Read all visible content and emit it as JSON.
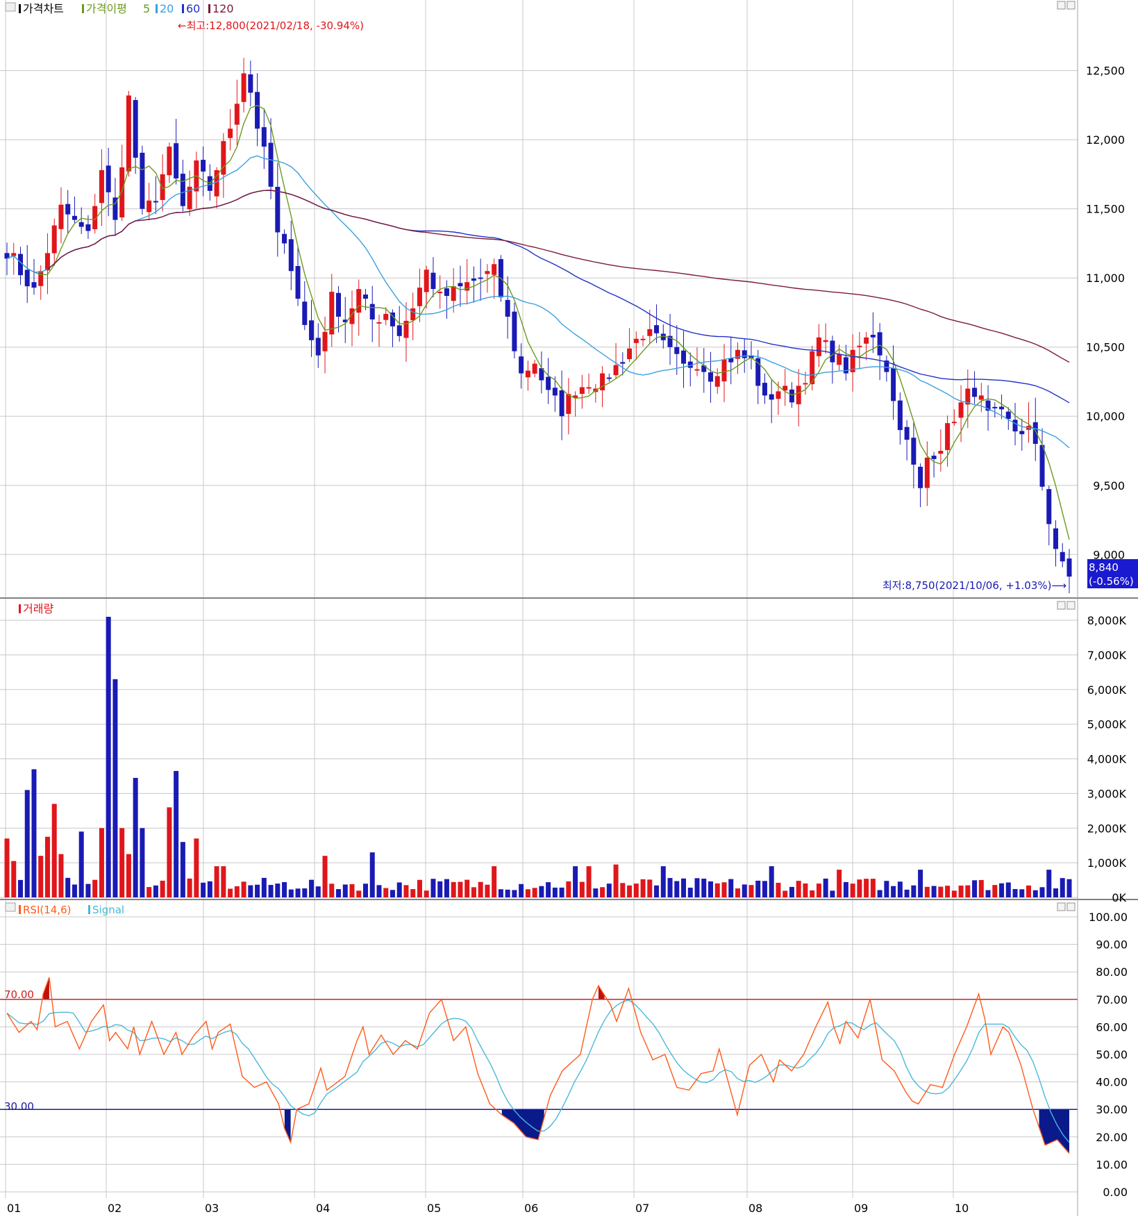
{
  "colors": {
    "up": "#e0161b",
    "down": "#1a1ab4",
    "ma5": "#6a9a1c",
    "ma20": "#3aa0e0",
    "ma60": "#2030c8",
    "ma120": "#7a1a3a",
    "rsi": "#ff5a1a",
    "signal": "#4ab8d8",
    "grid": "#c8c8c8",
    "line70": "#d02020",
    "line30": "#1a1aa0"
  },
  "price_panel": {
    "legend": {
      "title": "가격차트",
      "ma_label": "가격이평",
      "ma5": "5",
      "ma20": "20",
      "ma60": "60",
      "ma120": "120"
    },
    "high_note": "←최고:12,800(2021/02/18, -30.94%)",
    "low_note": "최저:8,750(2021/10/06, +1.03%)⟶",
    "last_price": "8,840",
    "last_change": "(-0.56%)",
    "y_ticks": [
      "12,500",
      "12,000",
      "11,500",
      "11,000",
      "10,500",
      "10,000",
      "9,500",
      "9,000"
    ]
  },
  "volume_panel": {
    "legend": "거래량",
    "y_ticks": [
      "8,000K",
      "7,000K",
      "6,000K",
      "5,000K",
      "4,000K",
      "3,000K",
      "2,000K",
      "1,000K",
      "0K"
    ]
  },
  "rsi_panel": {
    "legend_rsi": "RSI(14,6)",
    "legend_signal": "Signal",
    "level_high": "70.00",
    "level_low": "30.00",
    "y_ticks": [
      "100.00",
      "90.00",
      "80.00",
      "70.00",
      "60.00",
      "50.00",
      "40.00",
      "30.00",
      "20.00",
      "10.00",
      "0.00"
    ]
  },
  "x_ticks": [
    "01",
    "02",
    "03",
    "04",
    "05",
    "06",
    "07",
    "08",
    "09",
    "10"
  ],
  "chart_data": [
    {
      "type": "candlestick",
      "title": "가격차트",
      "period": "2021/01 - 2021/10",
      "ylim": [
        8700,
        12900
      ],
      "anchors": [
        [
          0,
          11200
        ],
        [
          4,
          10900
        ],
        [
          8,
          11500
        ],
        [
          12,
          11300
        ],
        [
          14,
          11800
        ],
        [
          16,
          11400
        ],
        [
          18,
          12300
        ],
        [
          20,
          11450
        ],
        [
          22,
          11600
        ],
        [
          24,
          11900
        ],
        [
          26,
          11500
        ],
        [
          28,
          11800
        ],
        [
          30,
          11650
        ],
        [
          33,
          12100
        ],
        [
          35,
          12500
        ],
        [
          36,
          12350
        ],
        [
          37,
          12100
        ],
        [
          38,
          11900
        ],
        [
          39,
          11650
        ],
        [
          40,
          11300
        ],
        [
          42,
          11100
        ],
        [
          44,
          10650
        ],
        [
          46,
          10450
        ],
        [
          48,
          10850
        ],
        [
          50,
          10700
        ],
        [
          52,
          10900
        ],
        [
          54,
          10700
        ],
        [
          56,
          10750
        ],
        [
          58,
          10600
        ],
        [
          60,
          10800
        ],
        [
          62,
          11050
        ],
        [
          64,
          10850
        ],
        [
          66,
          10900
        ],
        [
          68,
          10950
        ],
        [
          70,
          11000
        ],
        [
          72,
          11050
        ],
        [
          74,
          10700
        ],
        [
          76,
          10300
        ],
        [
          78,
          10400
        ],
        [
          80,
          10150
        ],
        [
          82,
          10050
        ],
        [
          84,
          10200
        ],
        [
          86,
          10250
        ],
        [
          88,
          10250
        ],
        [
          90,
          10350
        ],
        [
          92,
          10500
        ],
        [
          94,
          10600
        ],
        [
          96,
          10550
        ],
        [
          98,
          10450
        ],
        [
          100,
          10350
        ],
        [
          102,
          10400
        ],
        [
          104,
          10300
        ],
        [
          106,
          10400
        ],
        [
          108,
          10450
        ],
        [
          110,
          10400
        ],
        [
          112,
          10100
        ],
        [
          114,
          10200
        ],
        [
          116,
          10150
        ],
        [
          118,
          10300
        ],
        [
          120,
          10550
        ],
        [
          122,
          10450
        ],
        [
          124,
          10350
        ],
        [
          126,
          10500
        ],
        [
          128,
          10600
        ],
        [
          130,
          10350
        ],
        [
          131,
          10100
        ],
        [
          133,
          9800
        ],
        [
          135,
          9450
        ],
        [
          136,
          9700
        ],
        [
          138,
          9800
        ],
        [
          140,
          10000
        ],
        [
          142,
          10150
        ],
        [
          143,
          10200
        ],
        [
          145,
          10000
        ],
        [
          147,
          10000
        ],
        [
          149,
          9900
        ],
        [
          151,
          9900
        ],
        [
          152,
          9750
        ],
        [
          153,
          9500
        ],
        [
          154,
          9250
        ],
        [
          155,
          9050
        ],
        [
          156,
          8900
        ],
        [
          157,
          8840
        ]
      ],
      "ma_periods": [
        5,
        20,
        60,
        120
      ]
    },
    {
      "type": "bar",
      "title": "거래량",
      "unit": "K",
      "ylim": [
        0,
        8000
      ],
      "spikes": [
        [
          0,
          1700
        ],
        [
          1,
          1050
        ],
        [
          3,
          3100
        ],
        [
          4,
          3700
        ],
        [
          5,
          1200
        ],
        [
          6,
          1750
        ],
        [
          7,
          2700
        ],
        [
          8,
          1250
        ],
        [
          11,
          1900
        ],
        [
          14,
          2000
        ],
        [
          15,
          8100
        ],
        [
          16,
          6300
        ],
        [
          17,
          2000
        ],
        [
          18,
          1250
        ],
        [
          19,
          3450
        ],
        [
          20,
          2000
        ],
        [
          24,
          2600
        ],
        [
          25,
          3650
        ],
        [
          26,
          1600
        ],
        [
          28,
          1700
        ],
        [
          31,
          900
        ],
        [
          32,
          900
        ],
        [
          47,
          1200
        ],
        [
          54,
          1300
        ],
        [
          72,
          900
        ],
        [
          84,
          900
        ],
        [
          86,
          900
        ],
        [
          90,
          950
        ],
        [
          97,
          900
        ],
        [
          113,
          900
        ],
        [
          123,
          800
        ],
        [
          135,
          800
        ],
        [
          154,
          800
        ]
      ],
      "base_volume": 380
    },
    {
      "type": "line",
      "title": "RSI(14,6)",
      "series_names": [
        "RSI(14,6)",
        "Signal"
      ],
      "ylim": [
        0,
        100
      ],
      "levels": [
        70,
        30
      ],
      "rsi": [
        [
          0,
          65
        ],
        [
          2,
          58
        ],
        [
          4,
          62
        ],
        [
          5,
          59
        ],
        [
          6,
          72
        ],
        [
          7,
          78
        ],
        [
          8,
          60
        ],
        [
          10,
          62
        ],
        [
          12,
          52
        ],
        [
          14,
          62
        ],
        [
          16,
          68
        ],
        [
          17,
          55
        ],
        [
          18,
          58
        ],
        [
          19,
          55
        ],
        [
          20,
          52
        ],
        [
          21,
          60
        ],
        [
          22,
          50
        ],
        [
          24,
          62
        ],
        [
          26,
          50
        ],
        [
          28,
          58
        ],
        [
          29,
          50
        ],
        [
          31,
          57
        ],
        [
          33,
          62
        ],
        [
          34,
          52
        ],
        [
          35,
          58
        ],
        [
          37,
          61
        ],
        [
          39,
          42
        ],
        [
          41,
          38
        ],
        [
          43,
          40
        ],
        [
          45,
          32
        ],
        [
          46,
          23
        ],
        [
          47,
          18
        ],
        [
          48,
          30
        ],
        [
          50,
          32
        ],
        [
          52,
          45
        ],
        [
          53,
          37
        ],
        [
          56,
          42
        ],
        [
          58,
          55
        ],
        [
          59,
          60
        ],
        [
          60,
          50
        ],
        [
          62,
          57
        ],
        [
          64,
          50
        ],
        [
          66,
          55
        ],
        [
          68,
          52
        ],
        [
          70,
          65
        ],
        [
          72,
          70
        ],
        [
          74,
          55
        ],
        [
          76,
          60
        ],
        [
          78,
          43
        ],
        [
          80,
          32
        ],
        [
          82,
          28
        ],
        [
          84,
          25
        ],
        [
          86,
          20
        ],
        [
          88,
          19
        ],
        [
          90,
          35
        ],
        [
          92,
          44
        ],
        [
          95,
          50
        ],
        [
          97,
          70
        ],
        [
          98,
          75
        ],
        [
          100,
          68
        ],
        [
          101,
          62
        ],
        [
          103,
          74
        ],
        [
          105,
          58
        ],
        [
          107,
          48
        ],
        [
          109,
          50
        ],
        [
          111,
          38
        ],
        [
          113,
          37
        ],
        [
          115,
          43
        ],
        [
          117,
          44
        ],
        [
          118,
          52
        ],
        [
          120,
          36
        ],
        [
          121,
          28
        ],
        [
          123,
          46
        ],
        [
          125,
          50
        ],
        [
          127,
          40
        ],
        [
          128,
          48
        ],
        [
          130,
          44
        ],
        [
          132,
          50
        ],
        [
          134,
          60
        ],
        [
          136,
          69
        ],
        [
          137,
          60
        ],
        [
          138,
          54
        ],
        [
          139,
          62
        ],
        [
          141,
          56
        ],
        [
          143,
          70
        ],
        [
          145,
          48
        ],
        [
          147,
          44
        ],
        [
          149,
          36
        ],
        [
          150,
          33
        ],
        [
          151,
          32
        ],
        [
          153,
          39
        ],
        [
          155,
          38
        ],
        [
          157,
          50
        ],
        [
          159,
          60
        ],
        [
          161,
          72
        ],
        [
          162,
          63
        ],
        [
          163,
          50
        ],
        [
          165,
          60
        ],
        [
          166,
          58
        ],
        [
          168,
          46
        ],
        [
          170,
          30
        ],
        [
          172,
          17
        ],
        [
          174,
          19
        ],
        [
          176,
          14
        ]
      ],
      "signal_lag": 6
    }
  ]
}
